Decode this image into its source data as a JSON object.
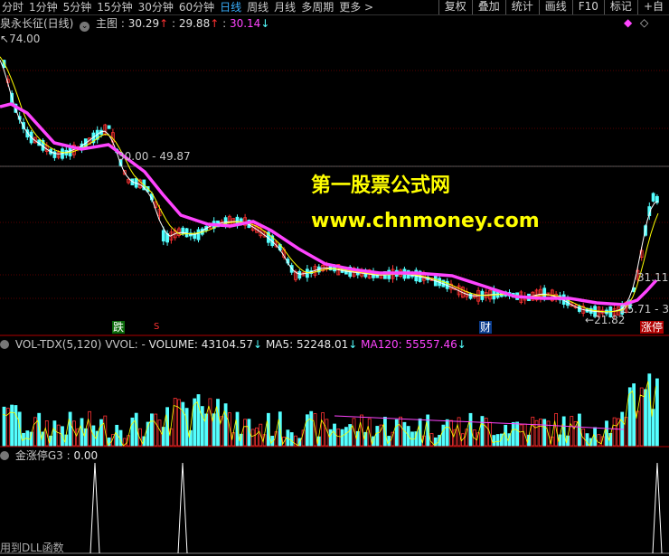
{
  "toolbar": {
    "periods": [
      "分时",
      "1分钟",
      "5分钟",
      "15分钟",
      "30分钟",
      "60分钟",
      "日线",
      "周线",
      "月线",
      "多周期",
      "更多 >"
    ],
    "active_period": 6,
    "tools": [
      "复权",
      "叠加",
      "统计",
      "画线",
      "F10",
      "标记",
      "+自"
    ]
  },
  "main_pane": {
    "stock_name": "泉永长征(日线)",
    "indicator": "主图",
    "v1": "30.29",
    "v2": "29.88",
    "v3": "30.14",
    "price_high_label": "74.00",
    "price_mid_label": "30.00 - 49.87",
    "price_low_label": "21.82",
    "price_right1": "31.11",
    "price_right2": "25.71 - 3",
    "tags": [
      "跌",
      "S",
      "财",
      "涨停"
    ]
  },
  "watermark": {
    "line1": "第一股票公式网",
    "line2": "www.chnmoney.com"
  },
  "vol_pane": {
    "name": "VOL-TDX(5,120)",
    "vvol": "VVOL: -",
    "volume": "VOLUME: 43104.57",
    "ma5": "MA5: 52248.01",
    "ma120": "MA120: 55557.46"
  },
  "ind_pane": {
    "name": "金涨停G3",
    "value": "0.00",
    "footer": "用到DLL函数"
  },
  "colors": {
    "up": "#ff3232",
    "down": "#54ffff",
    "ma_main": "#ff44ff",
    "ma_white": "#ffffff",
    "ma_yellow": "#ffff00",
    "grid": "#b00000",
    "accent": "#3ab0ff",
    "watermark": "#ffff00"
  }
}
